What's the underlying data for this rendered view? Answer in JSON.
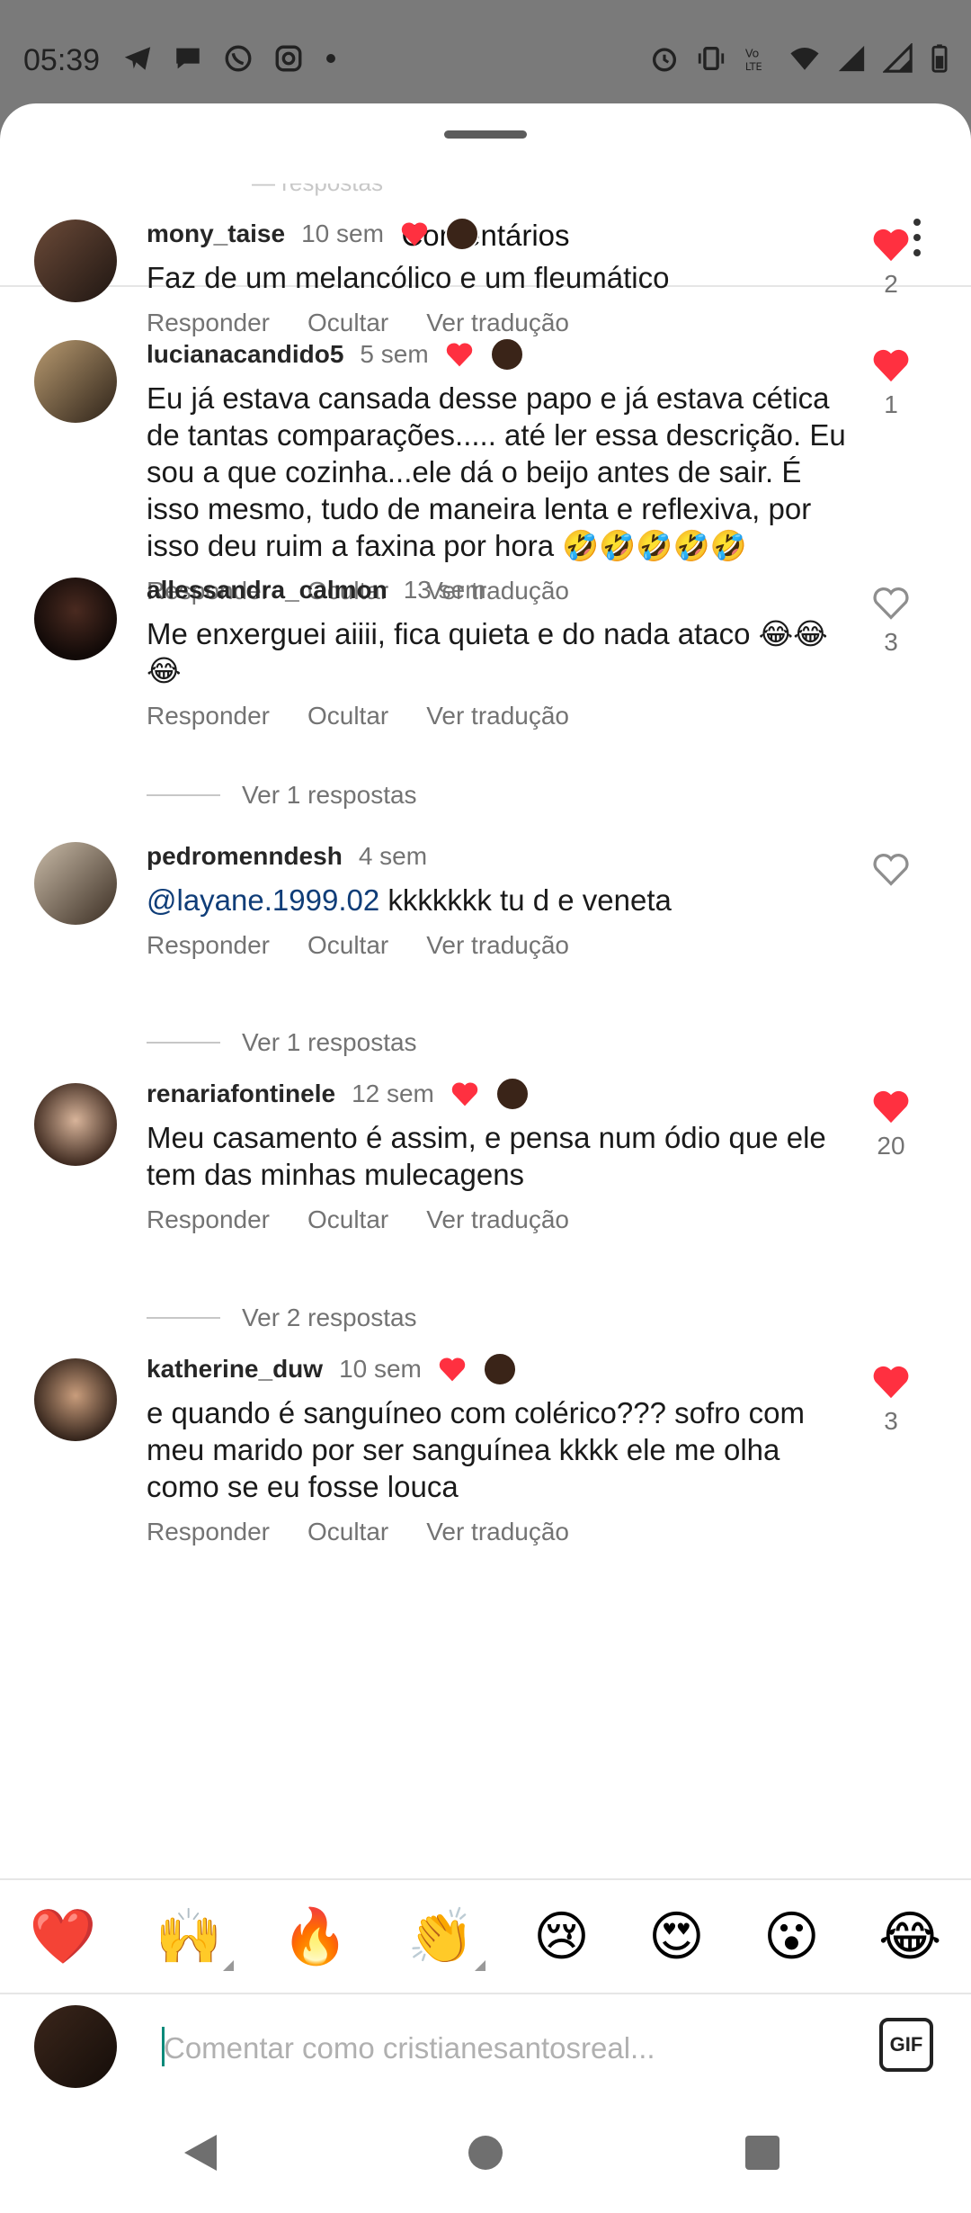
{
  "status_bar": {
    "time": "05:39",
    "left_icons": [
      "telegram-icon",
      "chat-icon",
      "whatsapp-icon",
      "instagram-icon",
      "dot-icon"
    ],
    "right_icons": [
      "alarm-icon",
      "vibrate-icon",
      "volte-icon",
      "wifi-icon",
      "signal-icon",
      "signal-icon-2",
      "battery-icon"
    ]
  },
  "sheet": {
    "title": "Comentários",
    "ghost_text": "— respostas"
  },
  "comments": [
    {
      "username": "mony_taise",
      "time": "10 sem",
      "creator_liked": true,
      "text": "Faz de um melancólico e um fleumático",
      "mention": "",
      "actions": [
        "Responder",
        "Ocultar",
        "Ver tradução"
      ],
      "liked": true,
      "likes": "2",
      "replies_label": ""
    },
    {
      "username": "lucianacandido5",
      "time": "5 sem",
      "creator_liked": true,
      "text": "Eu já estava cansada desse papo e já estava cética de tantas comparações..... até ler essa descrição. Eu sou a que cozinha...ele dá o beijo antes de sair. É isso mesmo, tudo de maneira lenta e reflexiva, por isso deu ruim a faxina por hora 🤣🤣🤣🤣🤣",
      "mention": "",
      "actions": [
        "Responder",
        "Ocultar",
        "Ver tradução"
      ],
      "liked": true,
      "likes": "1",
      "replies_label": ""
    },
    {
      "username": "allessandra_calmon",
      "time": "13 sem",
      "creator_liked": false,
      "text": "Me enxerguei aiiii, fica quieta e do nada ataco 😂😂😂",
      "mention": "",
      "actions": [
        "Responder",
        "Ocultar",
        "Ver tradução"
      ],
      "liked": false,
      "likes": "3",
      "replies_label": "Ver 1 respostas"
    },
    {
      "username": "pedromenndesh",
      "time": "4 sem",
      "creator_liked": false,
      "text": " kkkkkkk tu d e veneta",
      "mention": "@layane.1999.02",
      "actions": [
        "Responder",
        "Ocultar",
        "Ver tradução"
      ],
      "liked": false,
      "likes": "",
      "replies_label": "Ver 1 respostas"
    },
    {
      "username": "renariafontinele",
      "time": "12 sem",
      "creator_liked": true,
      "text": "Meu casamento é assim, e pensa num ódio que ele tem das minhas mulecagens",
      "mention": "",
      "actions": [
        "Responder",
        "Ocultar",
        "Ver tradução"
      ],
      "liked": true,
      "likes": "20",
      "replies_label": "Ver 2 respostas"
    },
    {
      "username": "katherine_duw",
      "time": "10 sem",
      "creator_liked": true,
      "text": "e quando é sanguíneo com colérico??? sofro com meu marido por ser sanguínea kkkk ele me olha como se eu fosse louca",
      "mention": "",
      "actions": [
        "Responder",
        "Ocultar",
        "Ver tradução"
      ],
      "liked": true,
      "likes": "3",
      "replies_label": ""
    }
  ],
  "reactions": [
    "❤️",
    "🙌",
    "🔥",
    "👏",
    "😢",
    "😍",
    "😮",
    "😂"
  ],
  "input": {
    "placeholder": "Comentar como cristianesantosreal...",
    "gif_label": "GIF"
  },
  "colors": {
    "like_red": "#ff3040",
    "mention_blue": "#0f3d78",
    "caret_teal": "#0a8a7a"
  }
}
